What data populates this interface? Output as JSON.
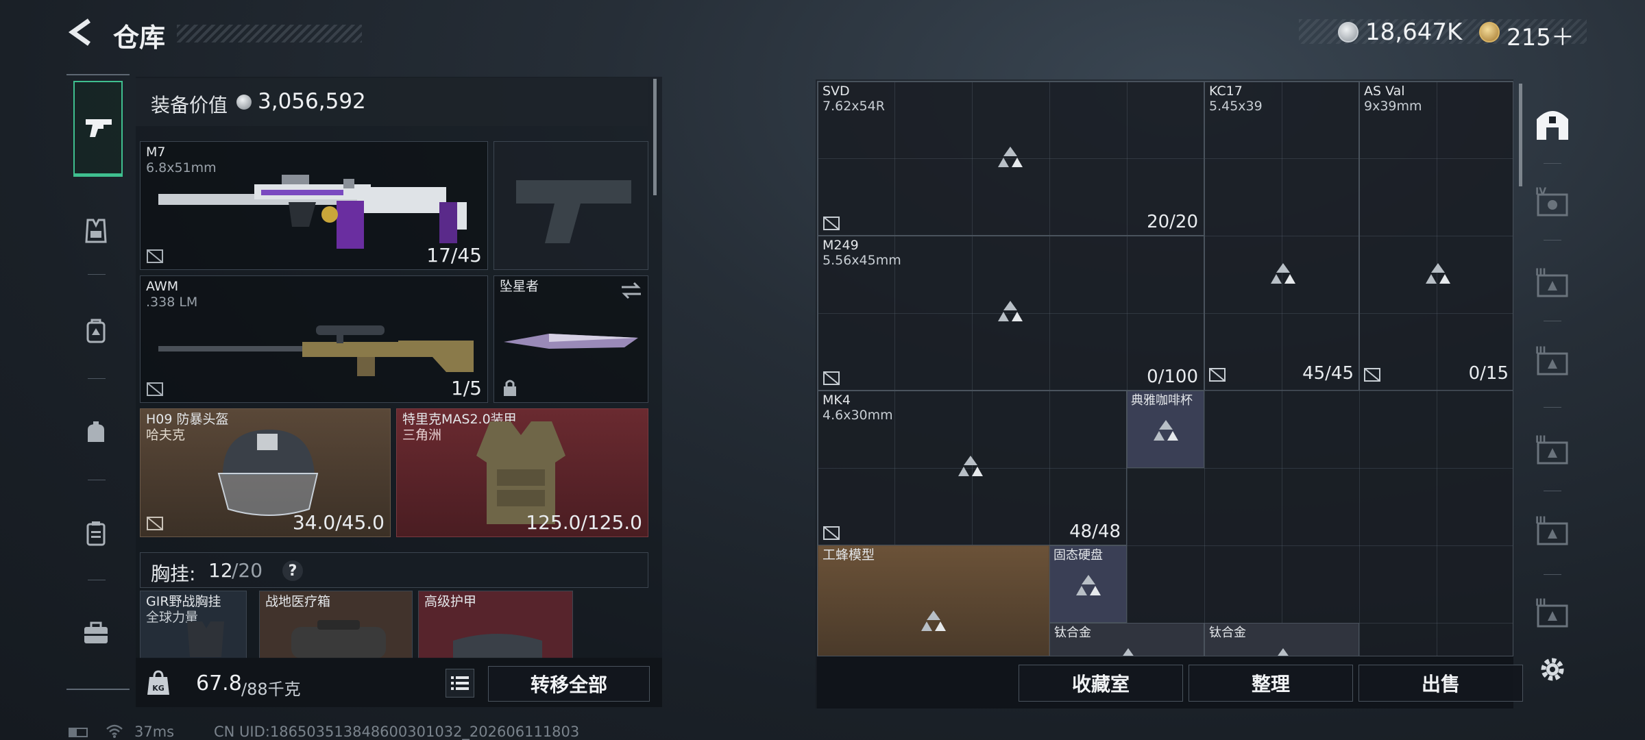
{
  "header": {
    "title": "仓库",
    "currency1": "18,647K",
    "currency2": "215＋"
  },
  "equip": {
    "label": "装备价值",
    "value": "3,056,592"
  },
  "weapons": {
    "primary": {
      "name": "M7",
      "ammo": "6.8x51mm",
      "count": "17/45"
    },
    "secondary": {
      "name": "AWM",
      "ammo": ".338 LM",
      "count": "1/5"
    },
    "melee": {
      "name": "坠星者"
    }
  },
  "armor": {
    "helmet": {
      "name": "H09 防暴头盔",
      "sub": "哈夫克",
      "dur": "34.0/45.0"
    },
    "vest": {
      "name": "特里克MAS2.0装甲",
      "sub": "三角洲",
      "dur": "125.0/125.0"
    }
  },
  "rig": {
    "label": "胸挂:",
    "used": "12",
    "total": "/20",
    "help": "?"
  },
  "rig_items": [
    {
      "name": "GIR野战胸挂",
      "sub": "全球力量"
    },
    {
      "name": "战地医疗箱"
    },
    {
      "name": "高级护甲"
    }
  ],
  "bottombar": {
    "weight": "67.8",
    "weight_cap": "/88千克",
    "transfer": "转移全部"
  },
  "status": {
    "ping": "37ms",
    "uid": "CN UID:186503513848600301032_202606111803"
  },
  "stash": {
    "items": [
      {
        "name": "SVD",
        "sub": "7.62x54R",
        "count": "20/20"
      },
      {
        "name": "KC17",
        "sub": "5.45x39"
      },
      {
        "name": "AS Val",
        "sub": "9x39mm"
      },
      {
        "name": "M249",
        "sub": "5.56x45mm",
        "count": "0/100"
      },
      {
        "name": "MK4",
        "sub": "4.6x30mm",
        "count": "48/48"
      },
      {
        "name": "典雅咖啡杯"
      },
      {
        "count": "45/45"
      },
      {
        "count": "0/15"
      },
      {
        "name": "工蜂模型"
      },
      {
        "name": "固态硬盘"
      },
      {
        "name": "钛合金"
      },
      {
        "name": "钛合金"
      }
    ],
    "buttons": {
      "collection": "收藏室",
      "sort": "整理",
      "sell": "出售"
    }
  },
  "colors": {
    "accent_green": "#3fbf8f",
    "helmet_bg": "#5a4838",
    "vest_bg": "#6a2a30",
    "gold_bg": "#6b5238",
    "blue_bg": "#3a3f55"
  }
}
